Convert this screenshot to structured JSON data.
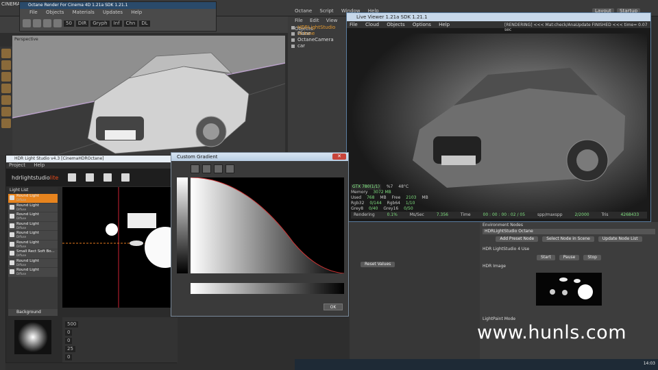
{
  "c4d": {
    "title": "CINEMA",
    "menu": [
      "Octane",
      "Script",
      "Window",
      "Help"
    ],
    "right_tags": [
      "Layout",
      "Startup"
    ],
    "viewport_label": "Perspective"
  },
  "octane_render_window": {
    "title": "Octane Render For Cinema 4D 1.21a  SDK 1.21.1",
    "menu": [
      "File",
      "Objects",
      "Materials",
      "Updates",
      "Help"
    ],
    "values": [
      "50",
      "DIR",
      "Gryph",
      "Inf",
      "Chn",
      "DL"
    ]
  },
  "objects_panel": {
    "header": [
      "File",
      "Edit",
      "View",
      "Objects"
    ],
    "items": [
      "HDRLightStudio Octane",
      "Plane",
      "OctaneCamera",
      "car"
    ]
  },
  "live_viewer": {
    "title": "Live Viewer 1.21a    SDK 1.21.1",
    "menu": [
      "File",
      "Cloud",
      "Objects",
      "Options",
      "Help"
    ],
    "status": "[RENDERING]  <<< Mat:check/AnaUpdate FINISHED <<< time= 0.07 sec"
  },
  "render_stats": {
    "gpu": "GTX 780(1/1)",
    "percent": "%7",
    "temp": "48°C",
    "memory_label": "Memory",
    "memory_value": "3072 MB",
    "used_label": "Used",
    "used_value": "768",
    "used_unit": "MB",
    "free_label": "Free",
    "free_value": "2103",
    "free_unit": "MB",
    "rgb32_label": "Rgb32",
    "rgb32_value": "0/144",
    "rgb64_label": "Rgb64",
    "rgb64_value": "1/10",
    "grey8_label": "Grey8",
    "grey8_value": "0/40",
    "grey16_label": "Grey16",
    "grey16_value": "0/50",
    "rendering_label": "Rendering",
    "rendering_value": "0.1%",
    "mss_label": "Ms/Sec",
    "mss_value": "7.356",
    "time_label": "Time",
    "time_value": "00 : 00 : 00 : 02 / 05",
    "spp_label": "spp/maxspp",
    "spp_value": "2/2000",
    "tris_label": "Tris",
    "tris_value": "4268433"
  },
  "environment_panel": {
    "env_nodes_label": "Environment Nodes",
    "env_select": "HDRLightStudio Octane",
    "node_buttons": [
      "Add Preset Node",
      "Select Node in Scene",
      "Update Node List"
    ],
    "hdrls_use_label": "HDR LightStudio 4 Use",
    "play_buttons": [
      "Start",
      "Pause",
      "Stop"
    ],
    "hdr_image_label": "HDR Image",
    "lightpaint_label": "LightPaint Mode",
    "reset_label": "Reset Values"
  },
  "hdr_light_studio": {
    "title": "HDR Light Studio v4.3 [CinemaHDROctane]",
    "menu": [
      "Project",
      "Help"
    ],
    "logo_main": "hdrlightstudio",
    "logo_accent": "lite",
    "light_list_label": "Light List",
    "lights": [
      {
        "name": "Round Light",
        "sub": "Diffuse"
      },
      {
        "name": "Round Light",
        "sub": "Diffuse"
      },
      {
        "name": "Round Light",
        "sub": "Diffuse"
      },
      {
        "name": "Round Light",
        "sub": "Diffuse"
      },
      {
        "name": "Round Light",
        "sub": "Diffuse"
      },
      {
        "name": "Round Light",
        "sub": "Diffuse"
      },
      {
        "name": "Small Rect Soft Bo...",
        "sub": "Diffuse"
      },
      {
        "name": "Round Light",
        "sub": "Diffuse"
      },
      {
        "name": "Round Light",
        "sub": "Diffuse"
      }
    ],
    "background_label": "Background",
    "prop_values": [
      "500",
      "0",
      "0",
      "25",
      "0"
    ]
  },
  "custom_gradient": {
    "title": "Custom Gradient",
    "close": "✕",
    "ok_label": "OK"
  },
  "taskbar": {
    "clock": "14:03"
  },
  "watermark": "www.hunls.com",
  "colors": {
    "accent_orange": "#e7841e",
    "logo_red": "#e84a1a",
    "stats_green": "#80e080"
  }
}
